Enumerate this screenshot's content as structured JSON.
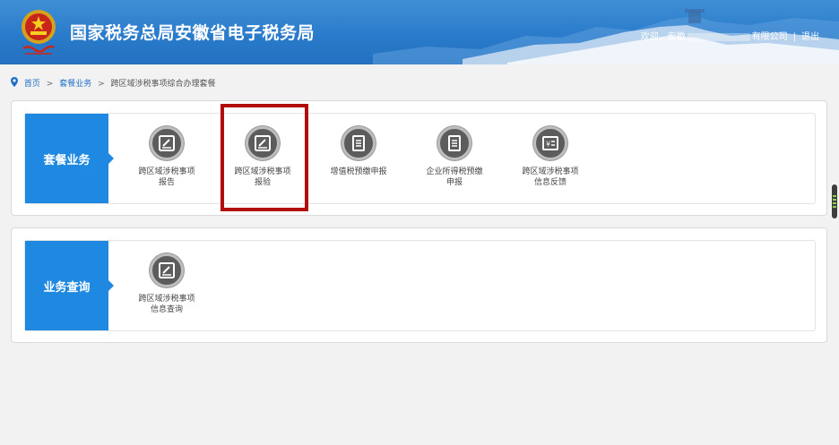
{
  "header": {
    "title": "国家税务总局安徽省电子税务局",
    "welcome": "欢迎，安徽",
    "company_suffix": "有限公司",
    "separator": "|",
    "logout": "退出"
  },
  "breadcrumb": {
    "home": "首页",
    "section": "套餐业务",
    "current": "跨区域涉税事项综合办理套餐",
    "sep": ">"
  },
  "panels": [
    {
      "category": "套餐业务",
      "items": [
        {
          "line1": "跨区域涉税事项",
          "line2": "报告",
          "icon": "edit-icon"
        },
        {
          "line1": "跨区域涉税事项",
          "line2": "报验",
          "icon": "edit-icon"
        },
        {
          "line1": "增值税预缴申报",
          "line2": "",
          "icon": "document-icon"
        },
        {
          "line1": "企业所得税预缴",
          "line2": "申报",
          "icon": "document-icon"
        },
        {
          "line1": "跨区域涉税事项",
          "line2": "信息反馈",
          "icon": "yen-icon"
        }
      ]
    },
    {
      "category": "业务查询",
      "items": [
        {
          "line1": "跨区域涉税事项",
          "line2": "信息查询",
          "icon": "edit-icon"
        }
      ]
    }
  ],
  "colors": {
    "header_blue": "#2a7bcb",
    "category_blue": "#1f88e1",
    "highlight_red": "#b20d0d",
    "icon_gray": "#5c5c5c"
  }
}
